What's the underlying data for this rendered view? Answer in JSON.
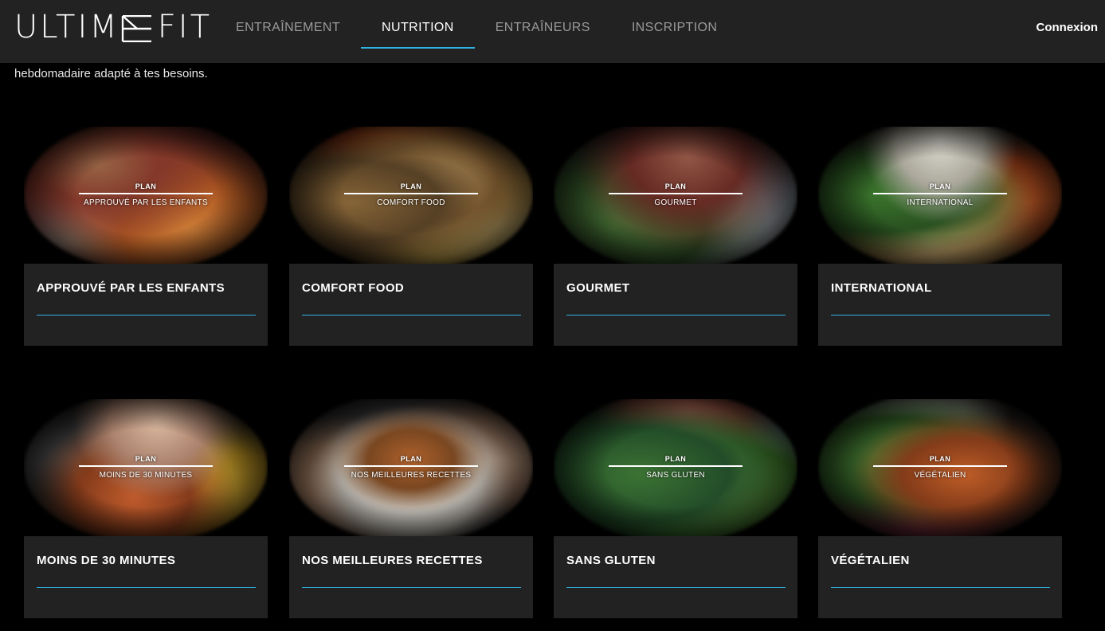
{
  "brand": {
    "logo_left": "ULTIM",
    "logo_right": "FIT"
  },
  "nav": [
    {
      "label": "ENTRAÎNEMENT",
      "active": false
    },
    {
      "label": "NUTRITION",
      "active": true
    },
    {
      "label": "ENTRAÎNEURS",
      "active": false
    },
    {
      "label": "INSCRIPTION",
      "active": false
    }
  ],
  "login_label": "Connexion",
  "intro_text": "hebdomadaire adapté à tes besoins.",
  "colors": {
    "accent": "#2fb3e3",
    "panel": "#222222",
    "header": "#222222"
  },
  "cards": [
    {
      "plan": "PLAN",
      "subtitle": "APPROUVÉ PAR LES ENFANTS",
      "title": "APPROUVÉ PAR LES ENFANTS",
      "image": "kids-pizza-photo"
    },
    {
      "plan": "PLAN",
      "subtitle": "COMFORT FOOD",
      "title": "COMFORT FOOD",
      "image": "grilled-chicken-photo"
    },
    {
      "plan": "PLAN",
      "subtitle": "GOURMET",
      "title": "GOURMET",
      "image": "gourmet-sandwich-photo"
    },
    {
      "plan": "PLAN",
      "subtitle": "INTERNATIONAL",
      "title": "INTERNATIONAL",
      "image": "international-dish-photo"
    },
    {
      "plan": "PLAN",
      "subtitle": "MOINS DE 30 MINUTES",
      "title": "MOINS DE 30 MINUTES",
      "image": "quick-salad-photo"
    },
    {
      "plan": "PLAN",
      "subtitle": "NOS MEILLEURES RECETTES",
      "title": "NOS MEILLEURES RECETTES",
      "image": "bowl-photo"
    },
    {
      "plan": "PLAN",
      "subtitle": "SANS GLUTEN",
      "title": "SANS GLUTEN",
      "image": "green-salad-photo"
    },
    {
      "plan": "PLAN",
      "subtitle": "VÉGÉTALIEN",
      "title": "VÉGÉTALIEN",
      "image": "vegan-salad-photo"
    }
  ]
}
